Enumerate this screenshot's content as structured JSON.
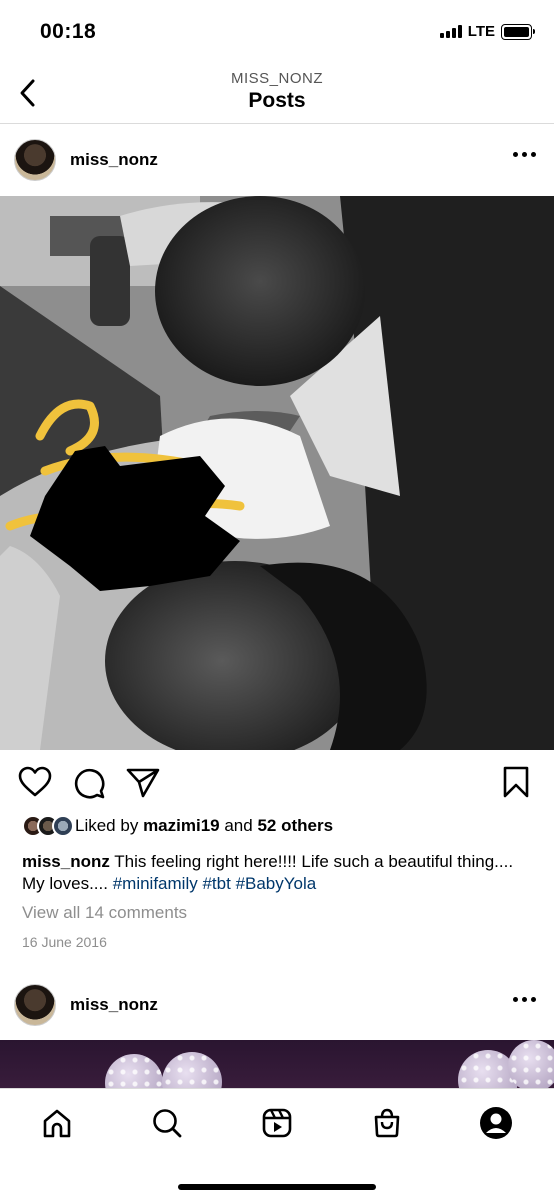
{
  "status_bar": {
    "time": "00:18",
    "network": "LTE"
  },
  "header": {
    "username": "MISS_NONZ",
    "title": "Posts"
  },
  "post": {
    "username": "miss_nonz",
    "likes": {
      "prefix": "Liked by",
      "user": "mazimi19",
      "connector": "and",
      "others": "52 others"
    },
    "caption": {
      "username": "miss_nonz",
      "text": "This feeling right here!!!! Life such a beautiful thing.... My loves....",
      "hashtags": [
        "#minifamily",
        "#tbt",
        "#BabyYola"
      ]
    },
    "comments_link": "View all 14 comments",
    "date": "16 June 2016"
  },
  "next_post": {
    "username": "miss_nonz"
  },
  "icons": {
    "back": "chevron-left-icon",
    "more": "more-horizontal-icon",
    "like": "heart-icon",
    "comment": "comment-icon",
    "share": "send-icon",
    "save": "bookmark-icon",
    "home": "home-icon",
    "search": "search-icon",
    "reels": "reels-icon",
    "shop": "shop-icon",
    "profile": "profile-icon"
  },
  "colors": {
    "hashtag": "#00376b",
    "secondary_text": "#8e8e8e"
  }
}
